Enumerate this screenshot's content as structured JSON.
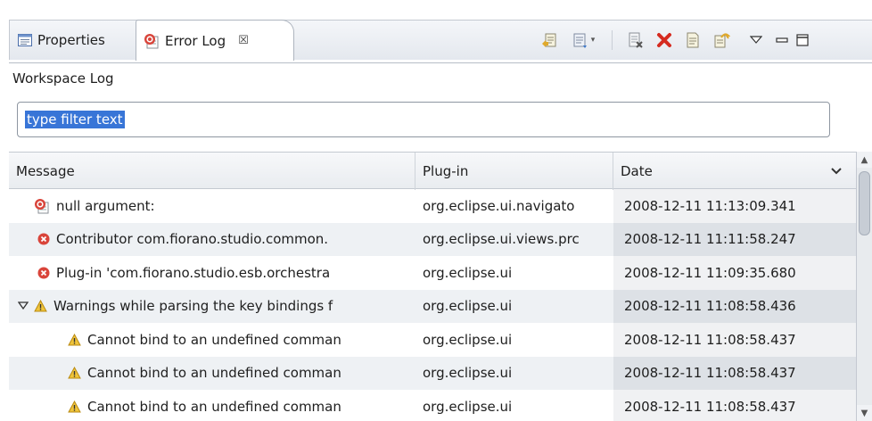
{
  "tabs": [
    {
      "label": "Properties",
      "icon": "properties-icon"
    },
    {
      "label": "Error Log",
      "icon": "error-log-icon",
      "close": "☒"
    }
  ],
  "toolbar": {
    "icons": [
      "export-log-icon",
      "import-log-icon",
      "clear-log-icon",
      "delete-log-icon",
      "open-log-icon",
      "restore-log-icon",
      "view-menu-icon",
      "minimize-icon",
      "maximize-icon"
    ]
  },
  "workspace": {
    "title": "Workspace Log"
  },
  "filter": {
    "value": "type filter text"
  },
  "table": {
    "columns": {
      "message": "Message",
      "plugin": "Plug-in",
      "date": "Date"
    },
    "rows": [
      {
        "severity": "error-bubble",
        "message": "null argument:",
        "plugin": "org.eclipse.ui.navigato",
        "date": "2008-12-11 11:13:09.341"
      },
      {
        "severity": "error",
        "message": "Contributor com.fiorano.studio.common.",
        "plugin": "org.eclipse.ui.views.prc",
        "date": "2008-12-11 11:11:58.247"
      },
      {
        "severity": "error",
        "message": "Plug-in 'com.fiorano.studio.esb.orchestra",
        "plugin": "org.eclipse.ui",
        "date": "2008-12-11 11:09:35.680"
      },
      {
        "severity": "warning",
        "message": "Warnings while parsing the key bindings f",
        "plugin": "org.eclipse.ui",
        "date": "2008-12-11 11:08:58.436",
        "expanded": true
      },
      {
        "severity": "warning",
        "message": "Cannot bind to an undefined comman",
        "plugin": "org.eclipse.ui",
        "date": "2008-12-11 11:08:58.437"
      },
      {
        "severity": "warning",
        "message": "Cannot bind to an undefined comman",
        "plugin": "org.eclipse.ui",
        "date": "2008-12-11 11:08:58.437"
      },
      {
        "severity": "warning",
        "message": "Cannot bind to an undefined comman",
        "plugin": "org.eclipse.ui",
        "date": "2008-12-11 11:08:58.437"
      }
    ]
  },
  "colors": {
    "error": "#d9443a",
    "warning": "#e8b320",
    "selection": "#3875d7"
  }
}
